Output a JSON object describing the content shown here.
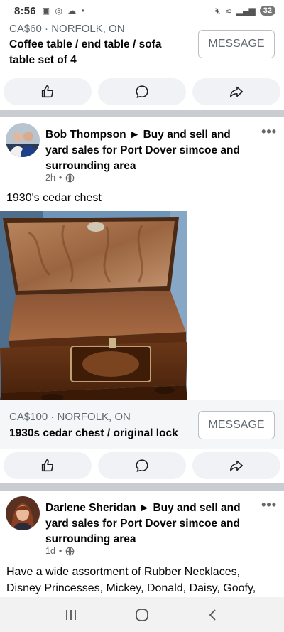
{
  "status_bar": {
    "time": "8:56",
    "battery": "32"
  },
  "listing1": {
    "price_location": "CA$60 · NORFOLK, ON",
    "title": "Coffee table / end table / sofa table set of 4",
    "message_label": "MESSAGE"
  },
  "post1": {
    "poster": "Bob Thompson ► Buy and sell and yard sales for Port Dover simcoe and surrounding area",
    "time": "2h",
    "text": "1930's cedar chest",
    "more": "•••"
  },
  "listing2": {
    "price_location": "CA$100 · NORFOLK, ON",
    "title": "1930s cedar chest / original lock",
    "message_label": "MESSAGE"
  },
  "post2": {
    "poster": "Darlene Sheridan ► Buy and sell and yard sales for Port Dover simcoe and surrounding area",
    "time": "1d",
    "text": "Have a wide assortment of Rubber Necklaces, Disney Princesses, Mickey, Donald, Daisy, Goofy,",
    "more": "•••"
  },
  "icons": [
    "like-icon",
    "comment-icon",
    "share-icon",
    "globe-icon",
    "recents-icon",
    "home-icon",
    "back-icon"
  ]
}
